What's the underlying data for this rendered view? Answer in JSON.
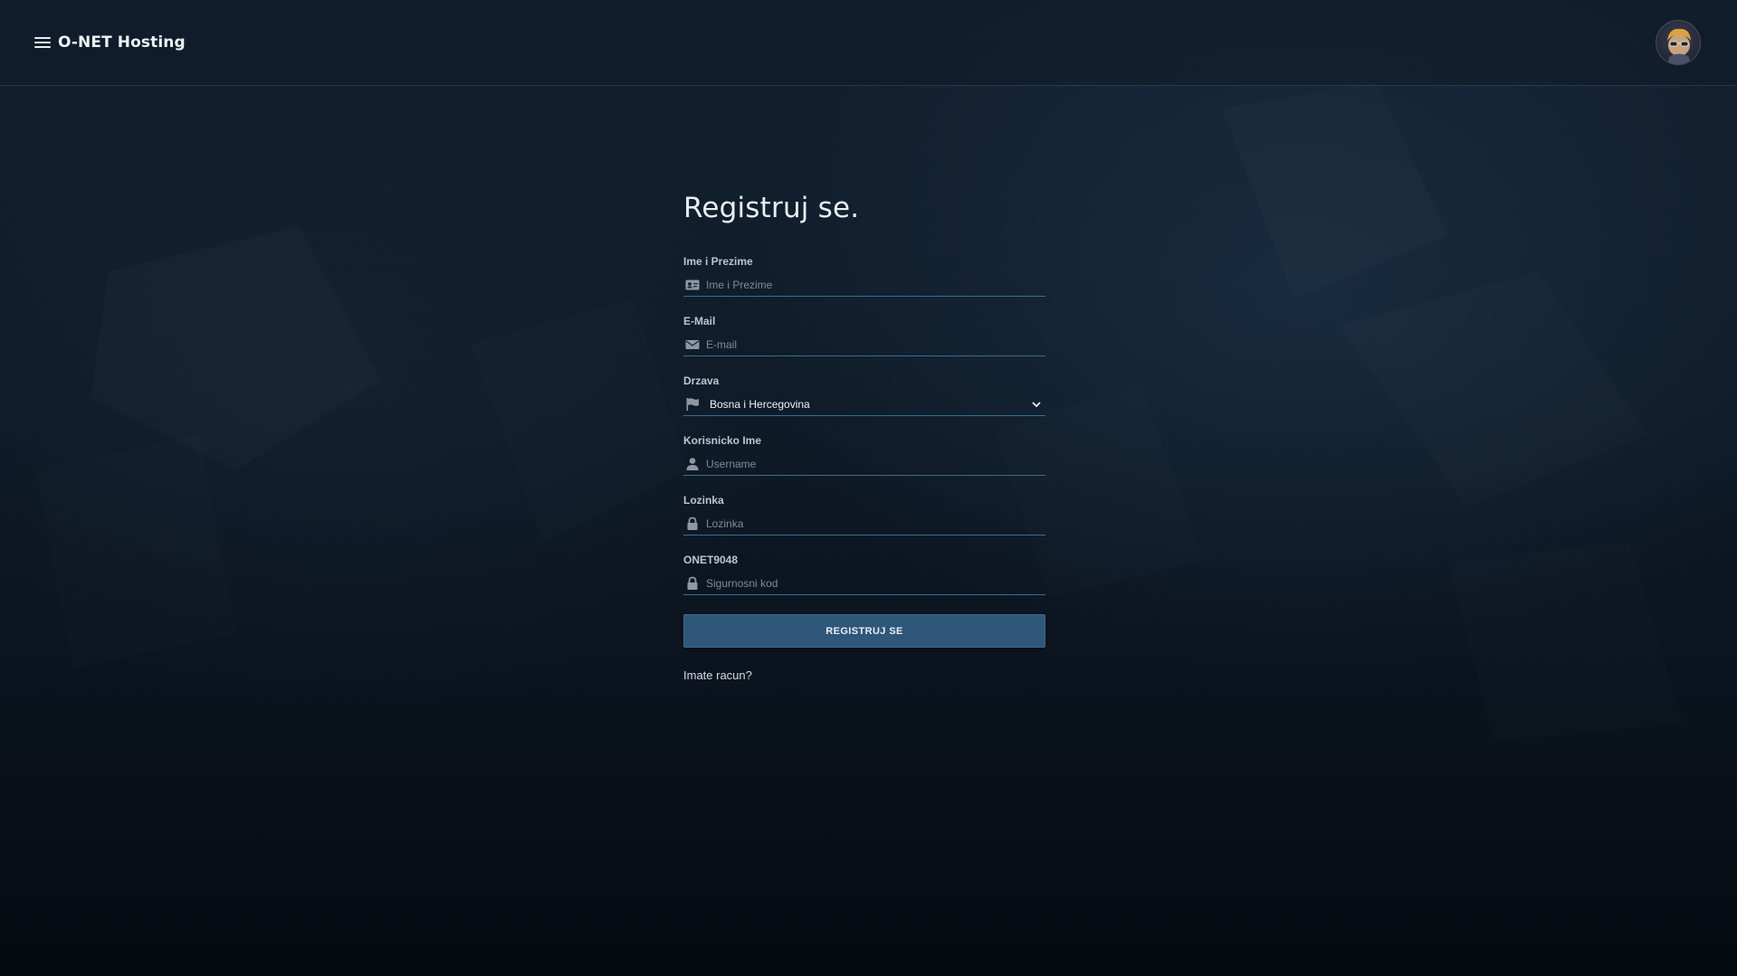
{
  "header": {
    "brand": "O-NET Hosting",
    "menu_icon": "hamburger-menu-icon",
    "avatar_icon": "user-avatar"
  },
  "form": {
    "title": "Registruj se.",
    "fields": {
      "full_name": {
        "label": "Ime i Prezime",
        "placeholder": "Ime i Prezime",
        "icon": "id-card-icon"
      },
      "email": {
        "label": "E-Mail",
        "placeholder": "E-mail",
        "icon": "envelope-icon"
      },
      "country": {
        "label": "Drzava",
        "value": "Bosna i Hercegovina",
        "icon": "flag-icon"
      },
      "username": {
        "label": "Korisnicko Ime",
        "placeholder": "Username",
        "icon": "user-icon"
      },
      "password": {
        "label": "Lozinka",
        "placeholder": "Lozinka",
        "icon": "lock-icon"
      },
      "security_code": {
        "label": "ONET9048",
        "placeholder": "Sigurnosni kod",
        "icon": "lock-icon"
      }
    },
    "submit_label": "REGISTRUJ SE",
    "login_link": "Imate racun?"
  },
  "colors": {
    "accent": "#2e5779",
    "underline": "#3a6d8f",
    "background": "#0f1b28"
  }
}
